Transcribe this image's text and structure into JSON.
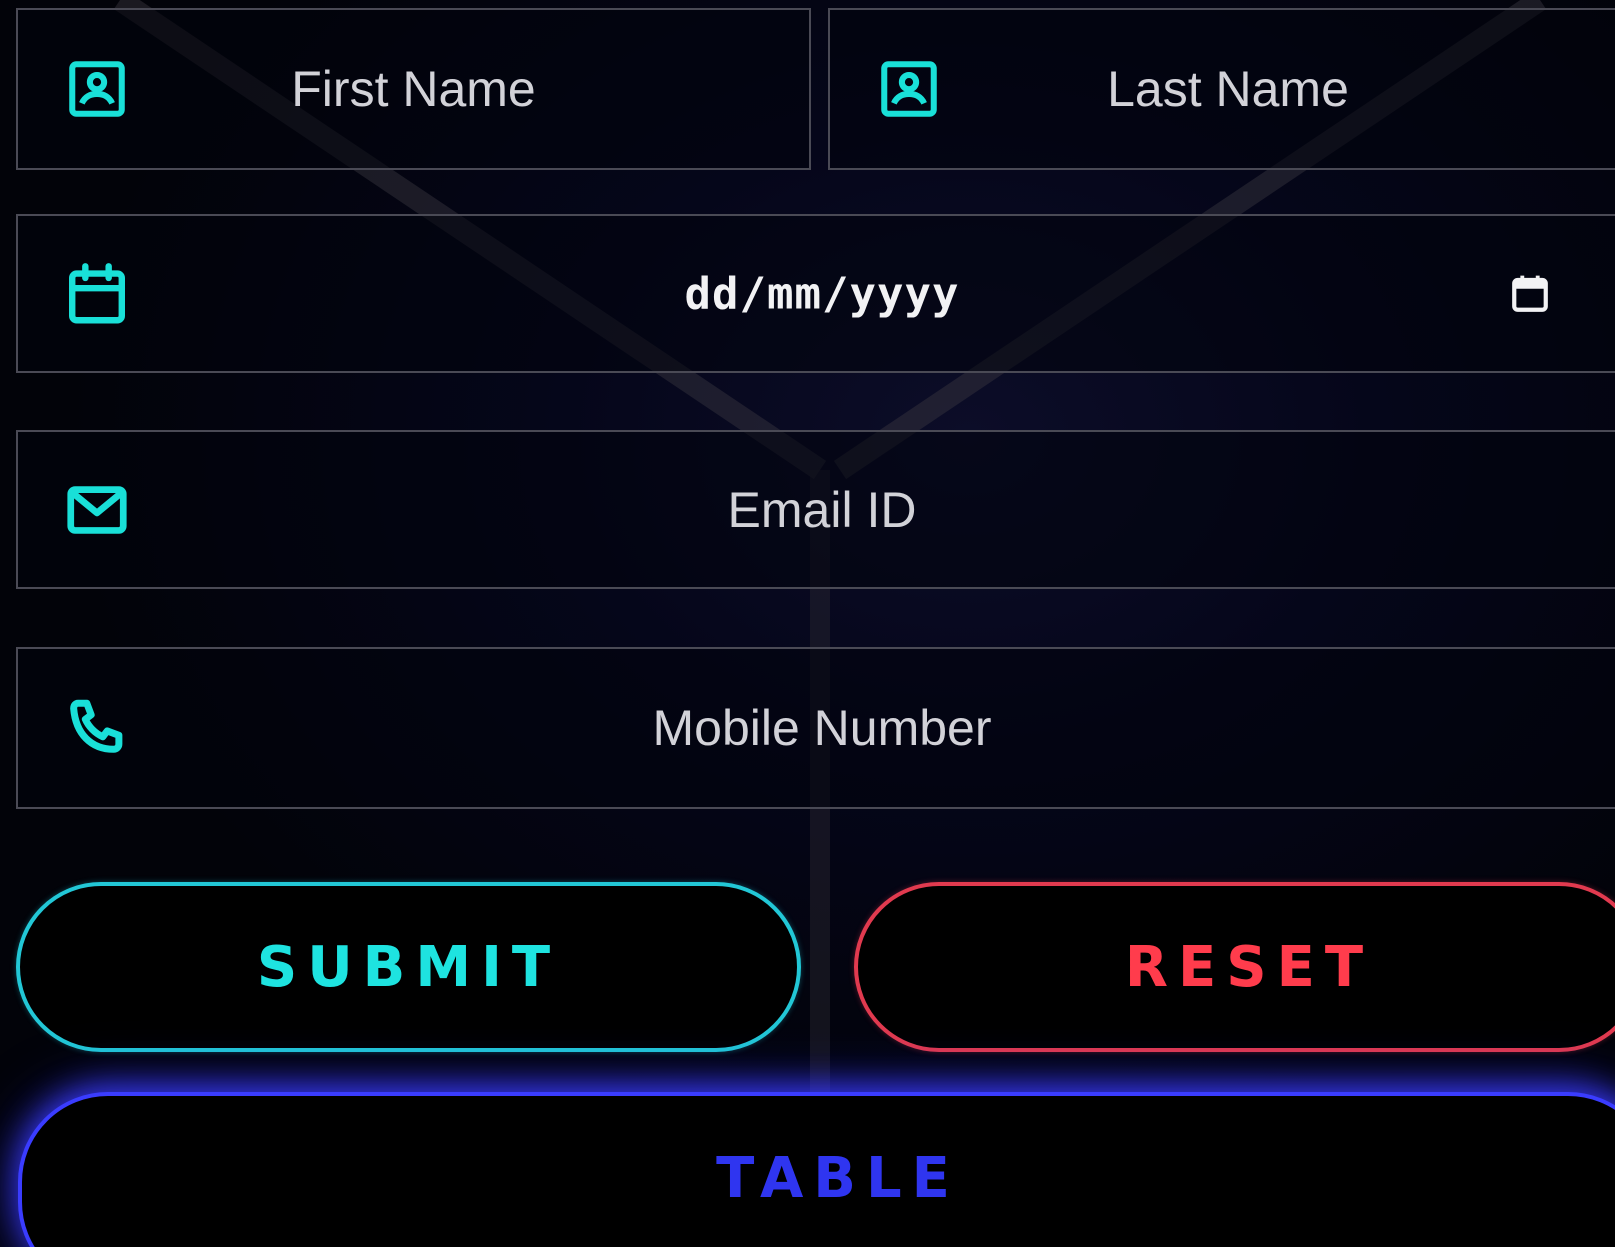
{
  "form": {
    "first_name": {
      "placeholder": "First Name",
      "icon": "user-card-icon"
    },
    "last_name": {
      "placeholder": "Last Name",
      "icon": "user-card-icon"
    },
    "date_of_birth": {
      "value": "dd/mm/yyyy",
      "icon": "calendar-icon",
      "picker_icon": "calendar-picker-icon"
    },
    "email": {
      "placeholder": "Email ID",
      "icon": "mail-icon"
    },
    "mobile": {
      "placeholder": "Mobile Number",
      "icon": "phone-icon"
    }
  },
  "buttons": {
    "submit_label": "SUBMIT",
    "reset_label": "RESET",
    "table_label": "TABLE"
  },
  "colors": {
    "accent_cyan": "#1ee3e0",
    "accent_red": "#ff3c4c",
    "accent_blue": "#2f35f0",
    "field_border": "#4a4a55",
    "background": "#02030a"
  }
}
